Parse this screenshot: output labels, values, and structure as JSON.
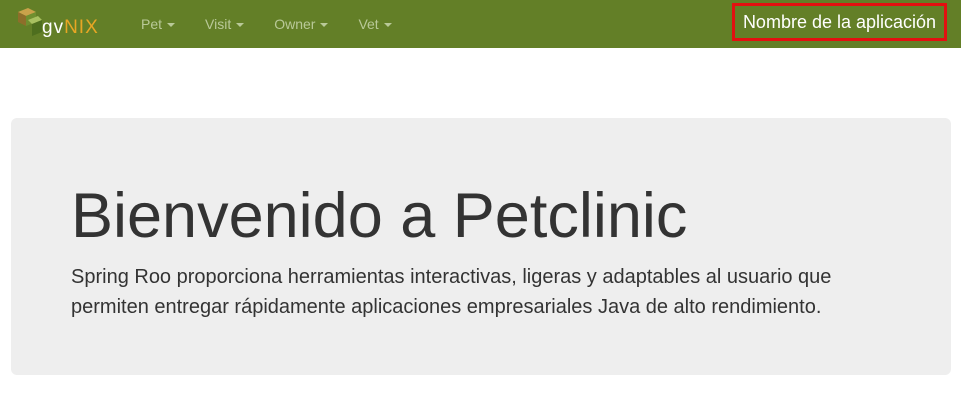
{
  "navbar": {
    "brand": {
      "gv_text": "gv",
      "nix_text": "NIX",
      "icon": "gvnix-logo-icon"
    },
    "menu": [
      {
        "label": "Pet"
      },
      {
        "label": "Visit"
      },
      {
        "label": "Owner"
      },
      {
        "label": "Vet"
      }
    ],
    "app_name": "Nombre de la aplicación"
  },
  "jumbotron": {
    "title": "Bienvenido a Petclinic",
    "description": "Spring Roo proporciona herramientas interactivas, ligeras y adaptables al usuario que permiten entregar rápidamente aplicaciones empresariales Java de alto rendimiento."
  },
  "colors": {
    "navbar_bg": "#637f27",
    "highlight_border": "#e31010",
    "jumbotron_bg": "#eeeeee"
  }
}
